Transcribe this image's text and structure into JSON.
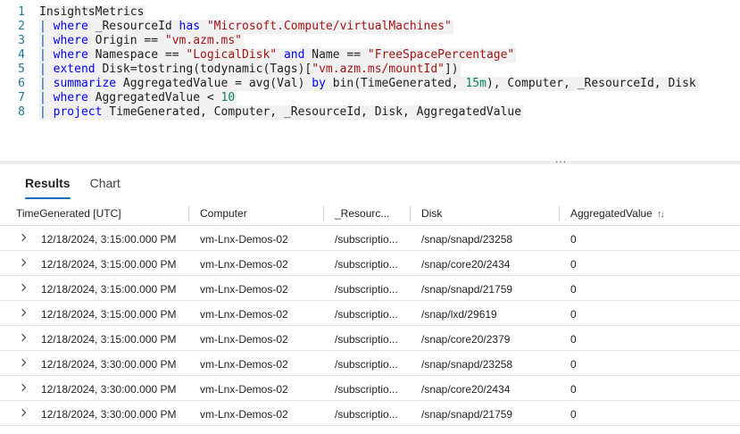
{
  "editor": {
    "lines": [
      {
        "no": "1"
      },
      {
        "no": "2"
      },
      {
        "no": "3"
      },
      {
        "no": "4"
      },
      {
        "no": "5"
      },
      {
        "no": "6"
      },
      {
        "no": "7"
      },
      {
        "no": "8"
      }
    ],
    "tokens": {
      "l1_table": "InsightsMetrics",
      "l2_kw": "where",
      "l2_text": " _ResourceId ",
      "l2_op": "has",
      "l2_str": "\"Microsoft.Compute/virtualMachines\"",
      "l3_kw": "where",
      "l3_text": " Origin == ",
      "l3_str": "\"vm.azm.ms\"",
      "l4_kw": "where",
      "l4_text1": " Namespace == ",
      "l4_str1": "\"LogicalDisk\"",
      "l4_and": "and",
      "l4_text2": " Name == ",
      "l4_str2": "\"FreeSpacePercentage\"",
      "l5_kw": "extend",
      "l5_text1": " Disk=tostring(todynamic(Tags)[",
      "l5_str": "\"vm.azm.ms/mountId\"",
      "l5_text2": "])",
      "l6_kw": "summarize",
      "l6_text1": " AggregatedValue = avg(Val) ",
      "l6_by": "by",
      "l6_text2": " bin(TimeGenerated, ",
      "l6_num": "15m",
      "l6_text3": "), Computer, _ResourceId, Disk",
      "l7_kw": "where",
      "l7_text": " AggregatedValue < ",
      "l7_num": "10",
      "l8_kw": "project",
      "l8_text": " TimeGenerated, Computer, _ResourceId, Disk, AggregatedValue",
      "pipe": "| "
    }
  },
  "splitter": {
    "grip": "..."
  },
  "tabs": {
    "results": "Results",
    "chart": "Chart"
  },
  "table": {
    "columns": [
      "TimeGenerated [UTC]",
      "Computer",
      "_Resourc...",
      "Disk",
      "AggregatedValue"
    ],
    "sort_icon": "↑↓",
    "rows": [
      [
        "12/18/2024, 3:15:00.000 PM",
        "vm-Lnx-Demos-02",
        "/subscriptio...",
        "/snap/snapd/23258",
        "0"
      ],
      [
        "12/18/2024, 3:15:00.000 PM",
        "vm-Lnx-Demos-02",
        "/subscriptio...",
        "/snap/core20/2434",
        "0"
      ],
      [
        "12/18/2024, 3:15:00.000 PM",
        "vm-Lnx-Demos-02",
        "/subscriptio...",
        "/snap/snapd/21759",
        "0"
      ],
      [
        "12/18/2024, 3:15:00.000 PM",
        "vm-Lnx-Demos-02",
        "/subscriptio...",
        "/snap/lxd/29619",
        "0"
      ],
      [
        "12/18/2024, 3:15:00.000 PM",
        "vm-Lnx-Demos-02",
        "/subscriptio...",
        "/snap/core20/2379",
        "0"
      ],
      [
        "12/18/2024, 3:30:00.000 PM",
        "vm-Lnx-Demos-02",
        "/subscriptio...",
        "/snap/snapd/23258",
        "0"
      ],
      [
        "12/18/2024, 3:30:00.000 PM",
        "vm-Lnx-Demos-02",
        "/subscriptio...",
        "/snap/core20/2434",
        "0"
      ],
      [
        "12/18/2024, 3:30:00.000 PM",
        "vm-Lnx-Demos-02",
        "/subscriptio...",
        "/snap/snapd/21759",
        "0"
      ]
    ]
  },
  "colors": {
    "accent": "#0f6cbd",
    "keyword": "#0000ff",
    "string": "#a31515",
    "number": "#098658",
    "line_number": "#237893"
  }
}
